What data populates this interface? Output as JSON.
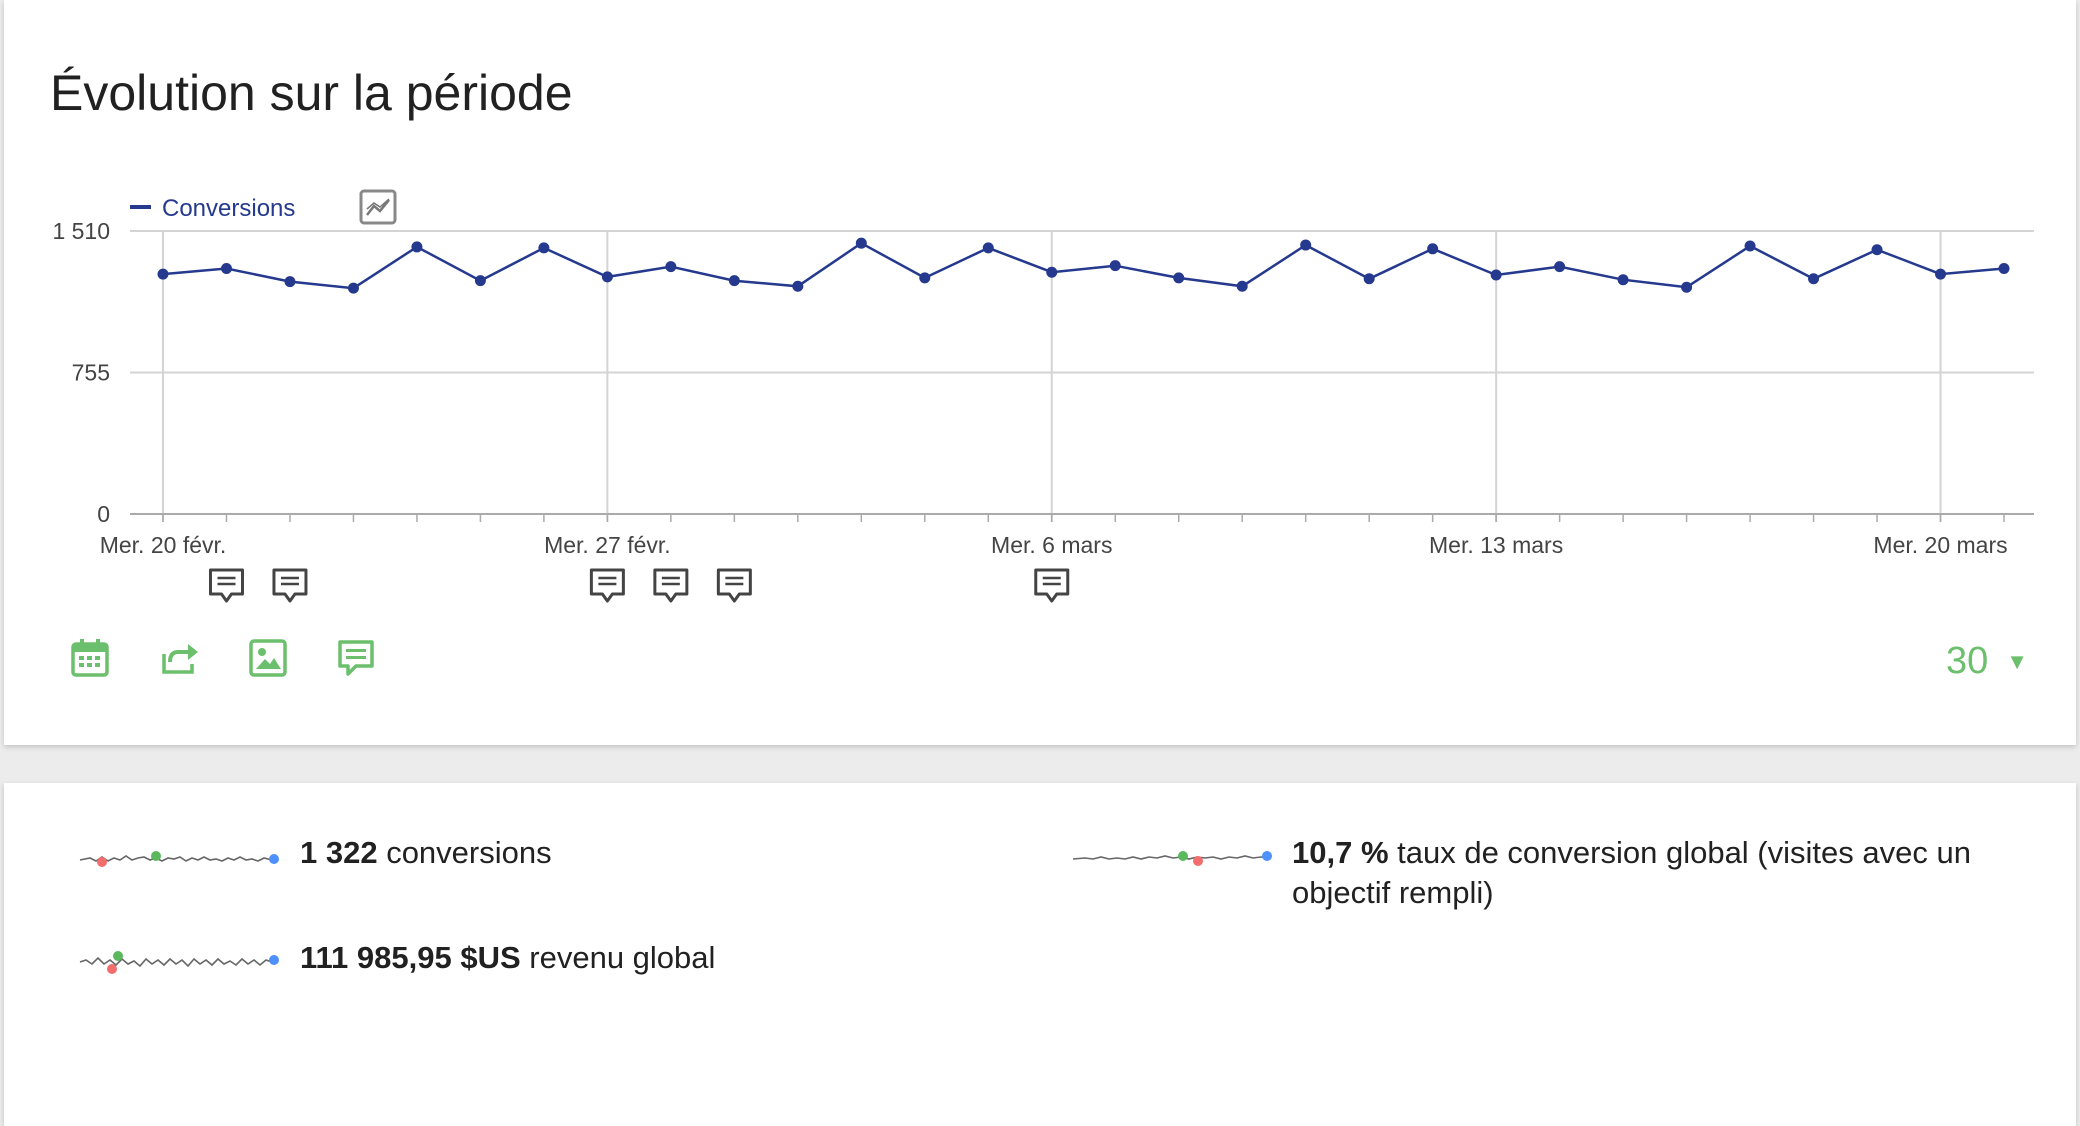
{
  "title": "Évolution sur la période",
  "chart_data": {
    "type": "line",
    "series": [
      {
        "name": "Conversions",
        "color": "#253a8e",
        "values": [
          1280,
          1310,
          1240,
          1205,
          1425,
          1245,
          1420,
          1265,
          1320,
          1245,
          1215,
          1445,
          1260,
          1420,
          1290,
          1325,
          1260,
          1215,
          1435,
          1255,
          1415,
          1275,
          1320,
          1250,
          1210,
          1430,
          1255,
          1410,
          1280,
          1310
        ]
      }
    ],
    "yticks": [
      "1 510",
      "755",
      "0"
    ],
    "ylim": [
      0,
      1510
    ],
    "xtick_labels": [
      "Mer. 20 févr.",
      "Mer. 27 févr.",
      "Mer. 6 mars",
      "Mer. 13 mars",
      "Mer. 20 mars"
    ],
    "annotation_days": [
      1,
      2,
      7,
      8,
      9,
      14
    ],
    "grid": true,
    "legend_position": "top-left"
  },
  "tools": {
    "calendar": "calendar-icon",
    "export": "export-icon",
    "image": "image-icon",
    "annotation": "annotation-icon"
  },
  "period": {
    "value": "30"
  },
  "metrics": [
    {
      "value": "1 322",
      "label": " conversions"
    },
    {
      "value": "10,7 %",
      "label": " taux de conversion global (visites avec un objectif rempli)"
    },
    {
      "value": "111 985,95 $US",
      "label": " revenu global"
    }
  ],
  "colors": {
    "accent_green": "#6cbf6c",
    "series_blue": "#253a8e",
    "spark_min": "#f26d6d",
    "spark_max": "#5cb85c",
    "spark_last": "#4d90fe"
  }
}
